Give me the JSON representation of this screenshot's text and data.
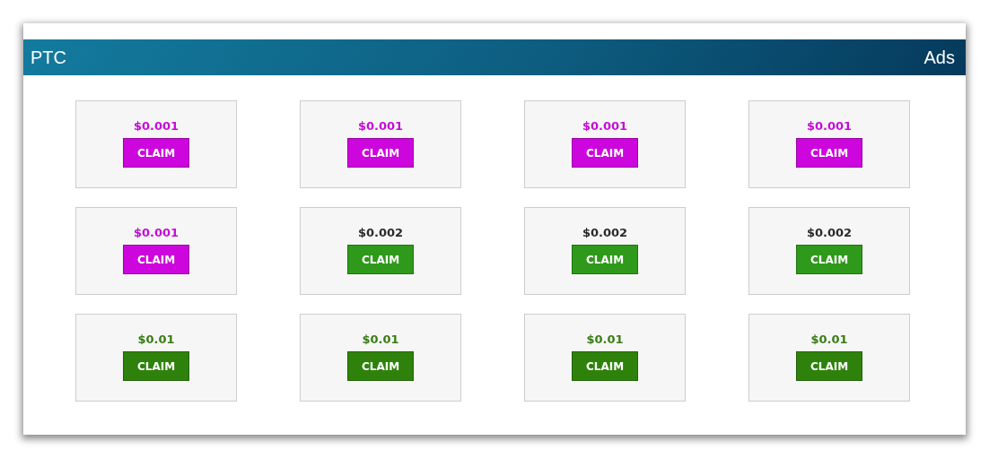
{
  "header": {
    "title": "PTC",
    "link": "Ads"
  },
  "ads": [
    {
      "price": "$0.001",
      "button": "CLAIM",
      "kind": "basic",
      "color": "#cc06dc"
    },
    {
      "price": "$0.001",
      "button": "CLAIM",
      "kind": "basic",
      "color": "#cc06dc"
    },
    {
      "price": "$0.001",
      "button": "CLAIM",
      "kind": "basic",
      "color": "#cc06dc"
    },
    {
      "price": "$0.001",
      "button": "CLAIM",
      "kind": "basic",
      "color": "#cc06dc"
    },
    {
      "price": "$0.001",
      "button": "CLAIM",
      "kind": "basic",
      "color": "#cc06dc"
    },
    {
      "price": "$0.002",
      "button": "CLAIM",
      "kind": "standard",
      "color": "#2e991a"
    },
    {
      "price": "$0.002",
      "button": "CLAIM",
      "kind": "standard",
      "color": "#2e991a"
    },
    {
      "price": "$0.002",
      "button": "CLAIM",
      "kind": "standard",
      "color": "#2e991a"
    },
    {
      "price": "$0.01",
      "button": "CLAIM",
      "kind": "premium",
      "color": "#2e820b"
    },
    {
      "price": "$0.01",
      "button": "CLAIM",
      "kind": "premium",
      "color": "#2e820b"
    },
    {
      "price": "$0.01",
      "button": "CLAIM",
      "kind": "premium",
      "color": "#2e820b"
    },
    {
      "price": "$0.01",
      "button": "CLAIM",
      "kind": "premium",
      "color": "#2e820b"
    }
  ]
}
